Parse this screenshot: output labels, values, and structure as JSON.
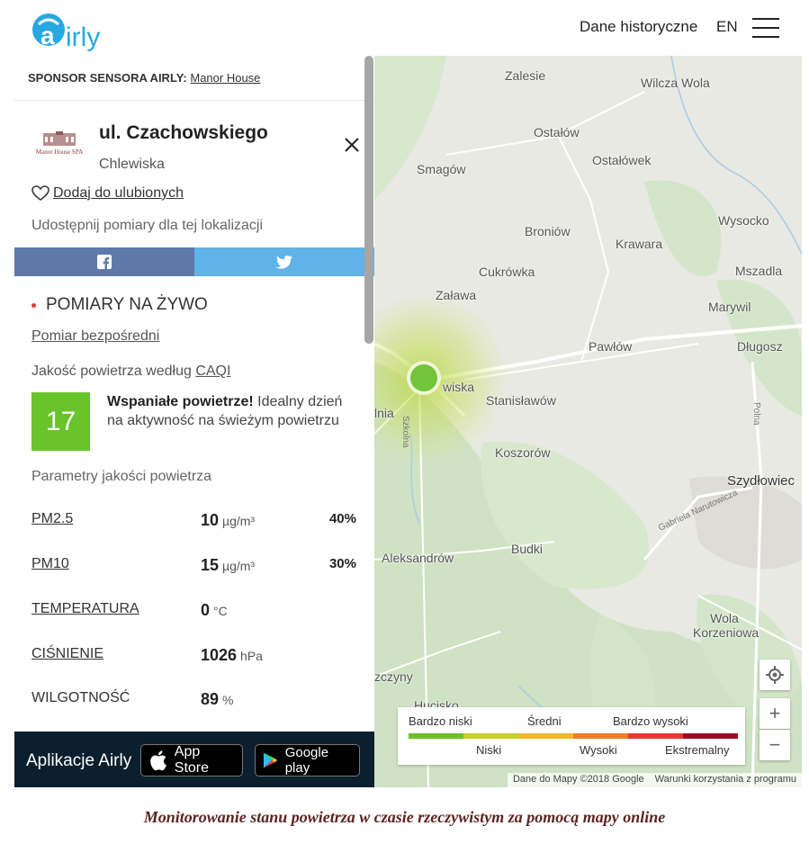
{
  "header": {
    "logo_text": "airly",
    "nav_historical": "Dane historyczne",
    "nav_language": "EN"
  },
  "panel": {
    "sponsor_label": "SPONSOR SENSORA AIRLY:",
    "sponsor_name": "Manor House",
    "sponsor_logo_text": "Manor House SPA",
    "location_title": "ul. Czachowskiego",
    "location_city": "Chlewiska",
    "favorite_label": "Dodaj do ulubionych",
    "share_label": "Udostępnij pomiary dla tej lokalizacji",
    "live_label": "POMIARY NA ŻYWO",
    "direct_label": "Pomiar bezpośredni",
    "caqi_prefix": "Jakość powietrza według",
    "caqi_link": "CAQI",
    "index_value": "17",
    "index_headline": "Wspaniałe powietrze!",
    "index_description": "Idealny dzień na aktywność na świeżym powietrzu",
    "index_color": "#69c32a",
    "params_title": "Parametry jakości powietrza",
    "params": [
      {
        "name": "PM2.5",
        "value": "10",
        "unit": "µg/m³",
        "percent": "40%"
      },
      {
        "name": "PM10",
        "value": "15",
        "unit": "µg/m³",
        "percent": "30%"
      },
      {
        "name": "TEMPERATURA",
        "value": "0",
        "unit": "°C",
        "percent": ""
      },
      {
        "name": "CIŚNIENIE",
        "value": "1026",
        "unit": "hPa",
        "percent": ""
      },
      {
        "name": "WILGOTNOŚĆ",
        "value": "89",
        "unit": "%",
        "percent": ""
      }
    ]
  },
  "apps": {
    "label": "Aplikacje Airly",
    "app_store": "App Store",
    "google_play": "Google play"
  },
  "map": {
    "places": [
      "Wilcza Wola",
      "Ostałów",
      "Smagów",
      "Ostałówek",
      "Wysocko",
      "Broniów",
      "Krawara",
      "Mszadla",
      "Cukrówka",
      "Zaława",
      "Marywil",
      "Pawłów",
      "Długosz",
      "Stanisławów",
      "Koszorów",
      "Szydłowiec",
      "Aleksandrów",
      "Budki",
      "Wola Korzeniowa",
      "lnia",
      "wiska",
      "zczyny",
      "Hucisko",
      "Zalesie"
    ],
    "road_labels": [
      "Szkolna",
      "Gabriela Narutowicza",
      "Polna"
    ],
    "legend": {
      "top": [
        "Bardzo niski",
        "Średni",
        "Bardzo wysoki"
      ],
      "bottom": [
        "Niski",
        "Wysoki",
        "Ekstremalny"
      ],
      "colors": [
        "#6dc02a",
        "#c6d22a",
        "#f0b92a",
        "#ee7d2a",
        "#e53935",
        "#9e0b25"
      ]
    },
    "attribution": "Dane do Mapy ©2018 Google",
    "terms": "Warunki korzystania z programu",
    "zoom_in": "+",
    "zoom_out": "−"
  },
  "caption": "Monitorowanie stanu powietrza w czasie rzeczywistym za pomocą mapy online"
}
